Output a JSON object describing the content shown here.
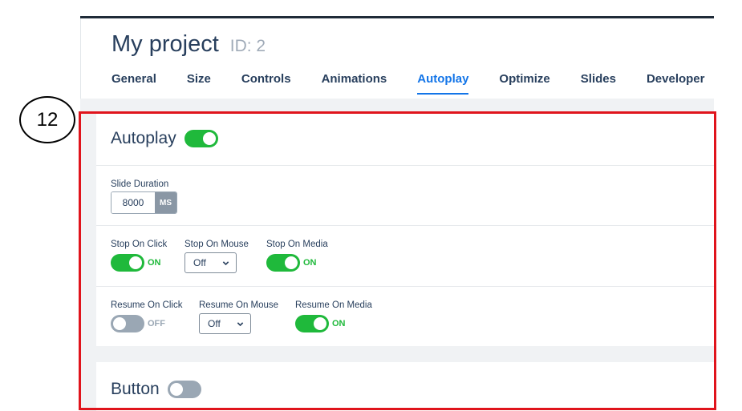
{
  "step_number": "12",
  "header": {
    "title": "My project",
    "id_label": "ID: 2"
  },
  "tabs": [
    {
      "label": "General",
      "active": false
    },
    {
      "label": "Size",
      "active": false
    },
    {
      "label": "Controls",
      "active": false
    },
    {
      "label": "Animations",
      "active": false
    },
    {
      "label": "Autoplay",
      "active": true
    },
    {
      "label": "Optimize",
      "active": false
    },
    {
      "label": "Slides",
      "active": false
    },
    {
      "label": "Developer",
      "active": false
    }
  ],
  "autoplay": {
    "title": "Autoplay",
    "enabled": true,
    "slide_duration": {
      "label": "Slide Duration",
      "value": "8000",
      "unit": "MS"
    },
    "stop_on_click": {
      "label": "Stop On Click",
      "state": "ON"
    },
    "stop_on_mouse": {
      "label": "Stop On Mouse",
      "value": "Off"
    },
    "stop_on_media": {
      "label": "Stop On Media",
      "state": "ON"
    },
    "resume_on_click": {
      "label": "Resume On Click",
      "state": "OFF"
    },
    "resume_on_mouse": {
      "label": "Resume On Mouse",
      "value": "Off"
    },
    "resume_on_media": {
      "label": "Resume On Media",
      "state": "ON"
    }
  },
  "button_section": {
    "title": "Button",
    "enabled": false
  },
  "colors": {
    "accent": "#1375e8",
    "toggle_on": "#1fb93b",
    "toggle_off": "#9aa7b4",
    "highlight_box": "#e0141c"
  }
}
